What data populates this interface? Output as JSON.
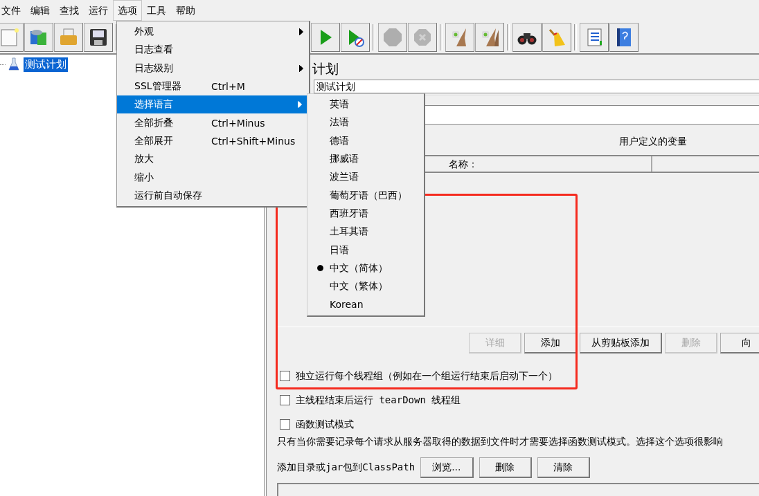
{
  "menubar": [
    {
      "label": "文件",
      "selected": false
    },
    {
      "label": "编辑",
      "selected": false
    },
    {
      "label": "查找",
      "selected": false
    },
    {
      "label": "运行",
      "selected": false
    },
    {
      "label": "选项",
      "selected": true
    },
    {
      "label": "工具",
      "selected": false
    },
    {
      "label": "帮助",
      "selected": false
    }
  ],
  "toolbar": {
    "left": [
      {
        "kind": "new",
        "disabled": false
      },
      {
        "kind": "templates",
        "disabled": false
      },
      {
        "kind": "open",
        "disabled": false
      },
      {
        "kind": "save",
        "disabled": false
      }
    ],
    "right": [
      {
        "kind": "start",
        "disabled": false
      },
      {
        "kind": "start-no-pause",
        "disabled": false
      },
      {
        "kind": "sep"
      },
      {
        "kind": "stop",
        "disabled": true
      },
      {
        "kind": "shutdown",
        "disabled": true
      },
      {
        "kind": "sep"
      },
      {
        "kind": "clear",
        "disabled": false
      },
      {
        "kind": "clear-all",
        "disabled": false
      },
      {
        "kind": "sep"
      },
      {
        "kind": "search",
        "disabled": false
      },
      {
        "kind": "reset-search",
        "disabled": false
      },
      {
        "kind": "sep"
      },
      {
        "kind": "function-list",
        "disabled": false
      },
      {
        "kind": "help",
        "disabled": false
      }
    ]
  },
  "tree": {
    "items": [
      {
        "label": "测试计划",
        "selected": true
      }
    ]
  },
  "panel": {
    "title": "计划",
    "name_field": {
      "value": "测试计划"
    },
    "variables": {
      "title": "用户定义的变量",
      "columns": [
        "名称："
      ]
    },
    "buttons": [
      {
        "label": "详细",
        "disabled": true
      },
      {
        "label": "添加",
        "disabled": false
      },
      {
        "label": "从剪贴板添加",
        "disabled": false
      },
      {
        "label": "删除",
        "disabled": true
      },
      {
        "label": "向",
        "disabled": false
      }
    ],
    "checkboxes": [
      {
        "label": "独立运行每个线程组（例如在一个组运行结束后启动下一个）",
        "checked": false
      },
      {
        "label": "主线程结束后运行 tearDown 线程组",
        "checked": false
      },
      {
        "label": "函数测试模式",
        "checked": false
      }
    ],
    "note": "只有当你需要记录每个请求从服务器取得的数据到文件时才需要选择函数测试模式。选择这个选项很影响",
    "classpath": {
      "label": "添加目录或jar包到ClassPath",
      "buttons": [
        {
          "label": "浏览...",
          "disabled": false
        },
        {
          "label": "删除",
          "disabled": false
        },
        {
          "label": "清除",
          "disabled": false
        }
      ]
    }
  },
  "menu": {
    "items": [
      {
        "label": "外观",
        "submenu": true,
        "selected": false
      },
      {
        "label": "日志查看",
        "submenu": false,
        "selected": false
      },
      {
        "label": "日志级别",
        "submenu": true,
        "selected": false
      },
      {
        "label": "SSL管理器",
        "shortcut": "Ctrl+M",
        "submenu": false,
        "selected": false
      },
      {
        "label": "选择语言",
        "submenu": true,
        "selected": true
      },
      {
        "label": "全部折叠",
        "shortcut": "Ctrl+Minus",
        "submenu": false,
        "selected": false
      },
      {
        "label": "全部展开",
        "shortcut": "Ctrl+Shift+Minus",
        "submenu": false,
        "selected": false
      },
      {
        "label": "放大",
        "submenu": false,
        "selected": false
      },
      {
        "label": "缩小",
        "submenu": false,
        "selected": false
      },
      {
        "label": "运行前自动保存",
        "submenu": false,
        "selected": false
      }
    ]
  },
  "submenu": {
    "items": [
      {
        "label": "英语",
        "selected": false
      },
      {
        "label": "法语",
        "selected": false
      },
      {
        "label": "德语",
        "selected": false
      },
      {
        "label": "挪威语",
        "selected": false
      },
      {
        "label": "波兰语",
        "selected": false
      },
      {
        "label": "葡萄牙语（巴西）",
        "selected": false
      },
      {
        "label": "西班牙语",
        "selected": false
      },
      {
        "label": "土耳其语",
        "selected": false
      },
      {
        "label": "日语",
        "selected": false
      },
      {
        "label": "中文（简体）",
        "selected": true
      },
      {
        "label": "中文（繁体）",
        "selected": false
      },
      {
        "label": "Korean",
        "selected": false
      }
    ]
  }
}
